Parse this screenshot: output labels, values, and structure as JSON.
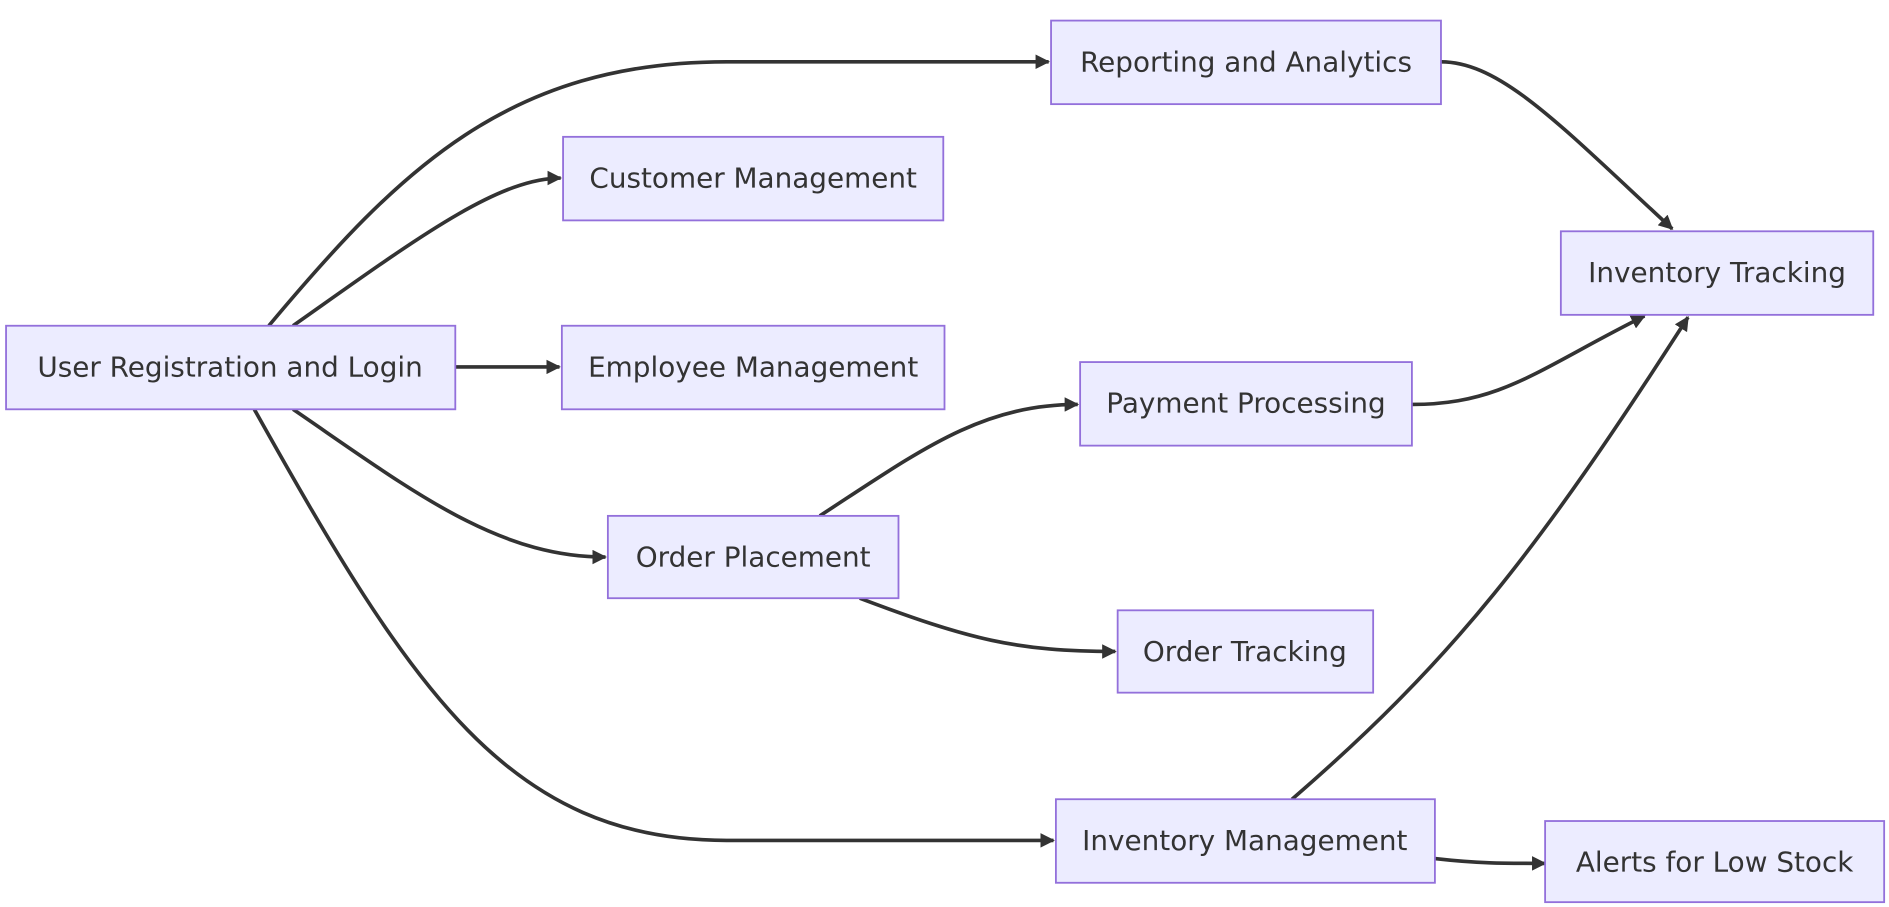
{
  "colors": {
    "node_fill": "#ECECFF",
    "node_stroke": "#9370DB",
    "edge": "#333333",
    "text": "#333333"
  },
  "nodes": {
    "login": "User Registration and Login",
    "reporting": "Reporting and Analytics",
    "customer": "Customer Management",
    "employee": "Employee Management",
    "order_placement": "Order Placement",
    "inventory_mgmt": "Inventory Management",
    "payment": "Payment Processing",
    "order_tracking": "Order Tracking",
    "inventory_tracking": "Inventory Tracking",
    "alerts": "Alerts for Low Stock"
  },
  "edges": [
    {
      "from": "login",
      "to": "reporting"
    },
    {
      "from": "login",
      "to": "customer"
    },
    {
      "from": "login",
      "to": "employee"
    },
    {
      "from": "login",
      "to": "order_placement"
    },
    {
      "from": "login",
      "to": "inventory_mgmt"
    },
    {
      "from": "order_placement",
      "to": "payment"
    },
    {
      "from": "order_placement",
      "to": "order_tracking"
    },
    {
      "from": "reporting",
      "to": "inventory_tracking"
    },
    {
      "from": "payment",
      "to": "inventory_tracking"
    },
    {
      "from": "inventory_mgmt",
      "to": "inventory_tracking"
    },
    {
      "from": "inventory_mgmt",
      "to": "alerts"
    }
  ]
}
